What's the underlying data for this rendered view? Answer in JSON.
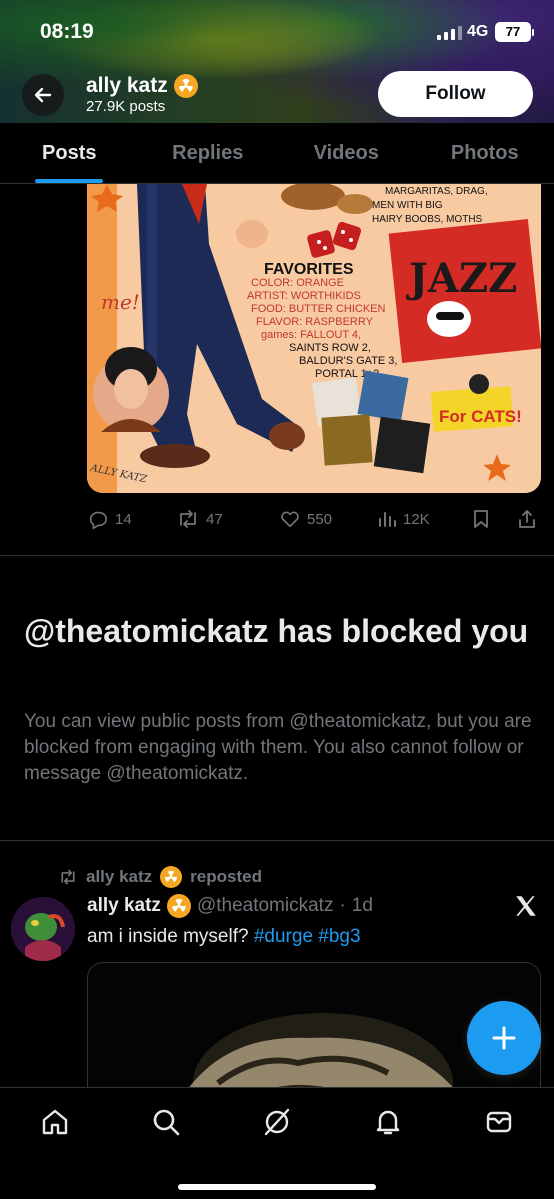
{
  "status_bar": {
    "time": "08:19",
    "network": "4G",
    "battery": "77"
  },
  "profile": {
    "name": "ally katz",
    "post_count": "27.9K posts",
    "badge_icon": "radioactive-icon",
    "follow_label": "Follow"
  },
  "tabs": [
    {
      "label": "Posts",
      "active": true
    },
    {
      "label": "Replies",
      "active": false
    },
    {
      "label": "Videos",
      "active": false
    },
    {
      "label": "Photos",
      "active": false
    }
  ],
  "post_image": {
    "texts": {
      "favorites": "FAVORITES",
      "color": "COLOR: ORANGE",
      "artist": "ARTIST: WORTHIKIDS",
      "food": "FOOD: BUTTER CHICKEN",
      "flavor": "FLAVOR: RASPBERRY",
      "games1": "games: FALLOUT 4,",
      "games2": "SAINTS ROW 2,",
      "games3": "BALDUR'S GATE 3,",
      "games4": "PORTAL 1+2",
      "top1": "MARGARITAS, DRAG,",
      "top2": "MEN WITH BIG",
      "top3": "HAIRY BOOBS, MOTHS",
      "me": "me!",
      "jazz": "JAZZ",
      "forcats": "For CATS!",
      "signature": "ALLY KATZ"
    }
  },
  "post_actions": {
    "replies": "14",
    "reposts": "47",
    "likes": "550",
    "views": "12K"
  },
  "blocked": {
    "title": "@theatomickatz has blocked you",
    "body": "You can view public posts from @theatomickatz, but you are blocked from engaging with them. You also cannot follow or message @theatomickatz."
  },
  "repost": {
    "reposter": "ally katz",
    "label": "reposted",
    "author": "ally katz",
    "handle": "@theatomickatz",
    "separator": "·",
    "time": "1d",
    "text": "am i inside myself?",
    "hashtags": [
      "#durge",
      "#bg3"
    ]
  },
  "colors": {
    "accent": "#1d9bf0",
    "muted": "#71767b",
    "text": "#e7e9ea",
    "border": "#2f3336",
    "badge": "#f5a623"
  },
  "bottom_nav": [
    {
      "icon": "home-icon"
    },
    {
      "icon": "search-icon"
    },
    {
      "icon": "grok-icon"
    },
    {
      "icon": "notifications-icon"
    },
    {
      "icon": "messages-icon"
    }
  ]
}
